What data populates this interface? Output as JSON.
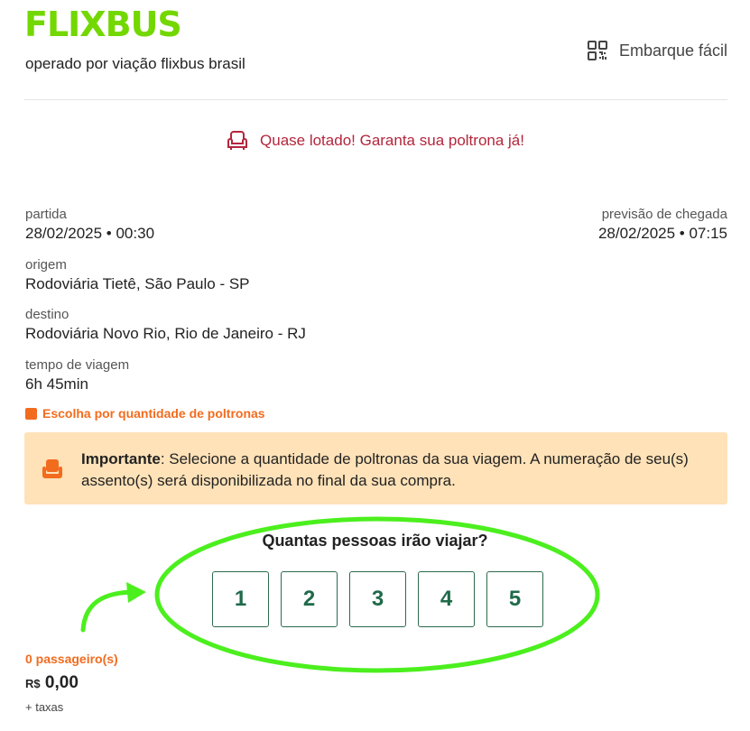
{
  "header": {
    "logo": "FLIXBUS",
    "operator": "operado por viação flixbus brasil",
    "boarding_label": "Embarque fácil"
  },
  "alert": {
    "text": "Quase lotado! Garanta sua poltrona já!"
  },
  "trip": {
    "departure_label": "partida",
    "departure_value": "28/02/2025 • 00:30",
    "arrival_label": "previsão de chegada",
    "arrival_value": "28/02/2025 • 07:15",
    "origin_label": "origem",
    "origin_value": "Rodoviária Tietê, São Paulo - SP",
    "destination_label": "destino",
    "destination_value": "Rodoviária Novo Rio, Rio de Janeiro - RJ",
    "duration_label": "tempo de viagem",
    "duration_value": "6h 45min"
  },
  "seat_choice": {
    "label": "Escolha por quantidade de poltronas"
  },
  "info": {
    "bold": "Importante",
    "text": ": Selecione a quantidade de poltronas da sua viagem. A numeração de seu(s) assento(s) será disponibilizada no final da sua compra."
  },
  "quantity": {
    "question": "Quantas pessoas irão viajar?",
    "options": [
      "1",
      "2",
      "3",
      "4",
      "5"
    ]
  },
  "summary": {
    "passengers": "0 passageiro(s)",
    "currency": "R$",
    "amount": "0,00",
    "taxes": "+ taxas"
  },
  "colors": {
    "brand": "#73d700",
    "alert": "#b3263c",
    "orange": "#f26c1e",
    "highlight": "#4cef1e",
    "button_text": "#1f6a4a"
  },
  "icons": [
    "qr-code-icon",
    "seat-icon",
    "arrow-icon"
  ]
}
